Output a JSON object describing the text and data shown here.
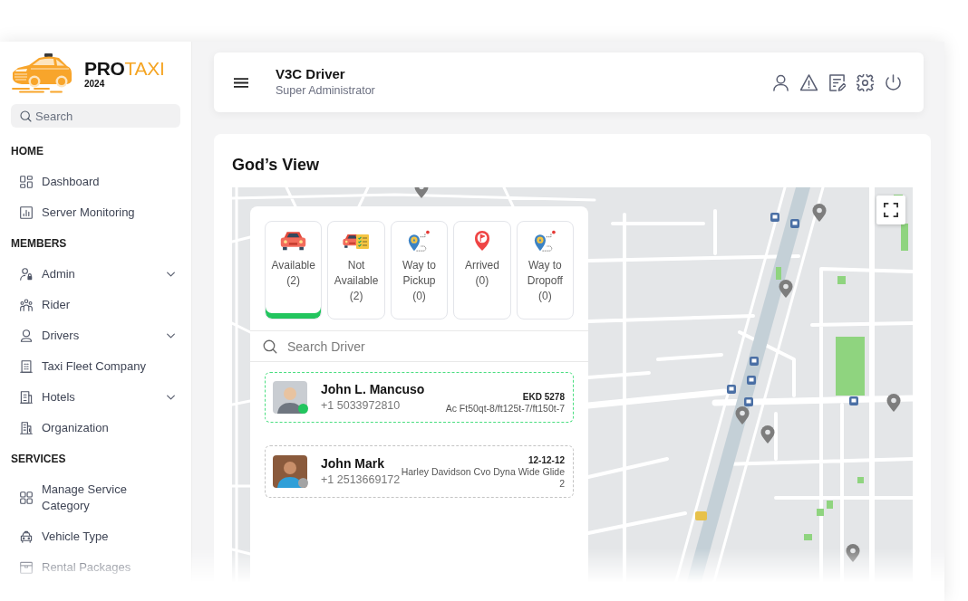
{
  "sidebar": {
    "logo": {
      "name_dark": "PRO",
      "name_accent": "TAXI",
      "year": "2024"
    },
    "search": {
      "placeholder": "Search"
    },
    "sections": [
      {
        "title": "HOME",
        "items": [
          {
            "label": "Dashboard",
            "kind": "link"
          },
          {
            "label": "Server Monitoring",
            "kind": "link"
          }
        ]
      },
      {
        "title": "MEMBERS",
        "items": [
          {
            "label": "Admin",
            "kind": "submenu"
          },
          {
            "label": "Rider",
            "kind": "link"
          },
          {
            "label": "Drivers",
            "kind": "submenu"
          },
          {
            "label": "Taxi Fleet Company",
            "kind": "link"
          },
          {
            "label": "Hotels",
            "kind": "submenu"
          },
          {
            "label": "Organization",
            "kind": "link"
          }
        ]
      },
      {
        "title": "SERVICES",
        "items": [
          {
            "label": "Manage Service Category",
            "kind": "link"
          },
          {
            "label": "Vehicle Type",
            "kind": "link"
          },
          {
            "label": "Rental Packages",
            "kind": "link"
          }
        ]
      }
    ]
  },
  "header": {
    "title": "V3C Driver",
    "subtitle": "Super Administrator"
  },
  "gods_view": {
    "title": "God’s View",
    "status_filters": [
      {
        "label": "Available",
        "count": "(2)",
        "selected": true
      },
      {
        "label": "Not Available",
        "count": "(2)",
        "selected": false
      },
      {
        "label": "Way to Pickup",
        "count": "(0)",
        "selected": false
      },
      {
        "label": "Arrived",
        "count": "(0)",
        "selected": false
      },
      {
        "label": "Way to Dropoff",
        "count": "(0)",
        "selected": false
      }
    ],
    "search": {
      "placeholder": "Search Driver"
    },
    "drivers": [
      {
        "name": "John L. Mancuso",
        "phone": "+1 5033972810",
        "plate": "EKD 5278",
        "vehicle": "Ac Ft50qt-8/ft125t-7/ft150t-7",
        "online": true,
        "selected": true
      },
      {
        "name": "John Mark",
        "phone": "+1 2513669172",
        "plate": "12-12-12",
        "vehicle": "Harley Davidson Cvo Dyna Wide Glide 2",
        "online": false,
        "selected": false
      }
    ]
  }
}
